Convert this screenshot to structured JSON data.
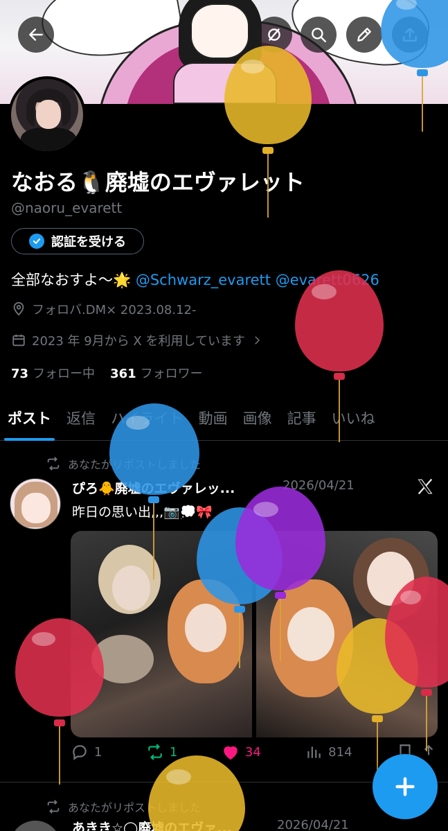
{
  "profile": {
    "display_name": "なおる🐧廃墟のエヴァレット",
    "handle": "@naoru_evarett",
    "verify_label": "認証を受ける",
    "bio_prefix": "全部なおすよ〜🌟",
    "bio_mention_1": "@Schwarz_evarett",
    "bio_mention_2": "@evarett0626",
    "location": "フォロバ.DM× 2023.08.12-",
    "joined": "2023 年 9月から X を利用しています",
    "following_count": "73",
    "following_label": "フォロー中",
    "followers_count": "361",
    "followers_label": "フォロワー"
  },
  "tabs": [
    "ポスト",
    "返信",
    "ハイライト",
    "動画",
    "画像",
    "記事",
    "いいね"
  ],
  "posts": [
    {
      "repost_label": "あなたがリポストしました",
      "author": "ぴろ🐥廃墟のエヴァレッ...",
      "date": "2026/04/21",
      "text": "昨日の思い出,,,📷💭🎀",
      "replies": "1",
      "reposts": "1",
      "likes": "34",
      "views": "814"
    },
    {
      "repost_label": "あなたがリポストしました",
      "author": "あきき☆◯廃墟のエヴァ...",
      "date": "2026/04/21"
    }
  ],
  "icons": {
    "back": "arrow-left-icon",
    "mute": "circle-slash-icon",
    "search": "search-icon",
    "edit": "pencil-icon",
    "share": "upload-icon",
    "compose": "plus-icon",
    "platform": "x-logo-icon"
  },
  "colors": {
    "accent": "#1d9bf0",
    "repost": "#00ba7c",
    "like": "#f91880",
    "muted": "#71767b"
  }
}
